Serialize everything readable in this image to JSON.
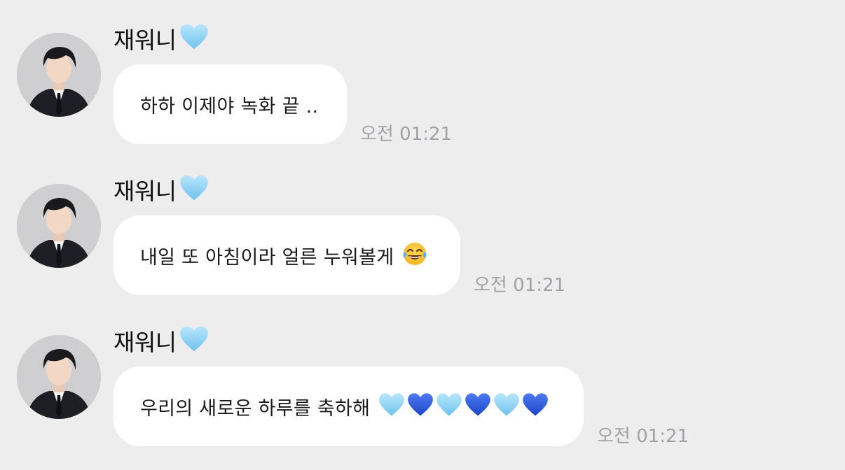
{
  "messages": [
    {
      "sender": "재워니",
      "sender_badge": "light-blue-heart-icon",
      "text": "하하 이제야 녹화 끝 ..",
      "emojis": [],
      "time": "오전 01:21"
    },
    {
      "sender": "재워니",
      "sender_badge": "light-blue-heart-icon",
      "text": "내일 또 아침이라 얼른 누워볼게",
      "emojis": [
        "tears-of-joy-icon"
      ],
      "time": "오전 01:21"
    },
    {
      "sender": "재워니",
      "sender_badge": "light-blue-heart-icon",
      "text": "우리의 새로운 하루를 축하해",
      "emojis": [
        "light-blue-heart-icon",
        "blue-heart-icon",
        "light-blue-heart-icon",
        "blue-heart-icon",
        "light-blue-heart-icon",
        "blue-heart-icon"
      ],
      "time": "오전 01:21"
    }
  ],
  "colors": {
    "background": "#ededee",
    "bubble": "#ffffff",
    "timestamp": "#a2a2a6",
    "light_blue_heart": "#8fd3f4",
    "blue_heart": "#2f5fe0"
  }
}
